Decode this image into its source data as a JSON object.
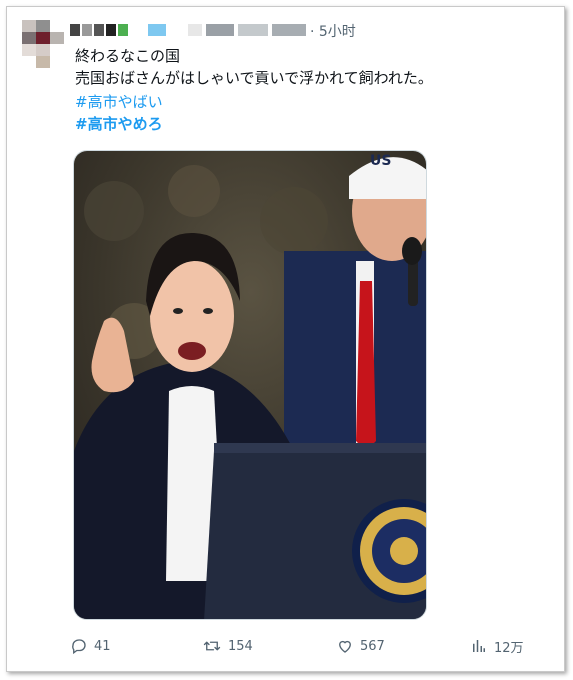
{
  "tweet": {
    "time": "· 5小时",
    "lines": [
      "終わるなこの国",
      "売国おばさんがはしゃいで貢いで浮かれて飼われた。"
    ],
    "hashtags": [
      "#高市やばい",
      "#高市やめろ"
    ]
  },
  "actions": {
    "replies": "41",
    "retweets": "154",
    "likes": "567",
    "views": "12万"
  },
  "icons": {
    "reply": "reply-icon",
    "retweet": "retweet-icon",
    "like": "heart-icon",
    "views": "views-bar-chart-icon"
  },
  "colors": {
    "text": "#0f1419",
    "muted": "#536471",
    "link": "#1d9bf0"
  }
}
